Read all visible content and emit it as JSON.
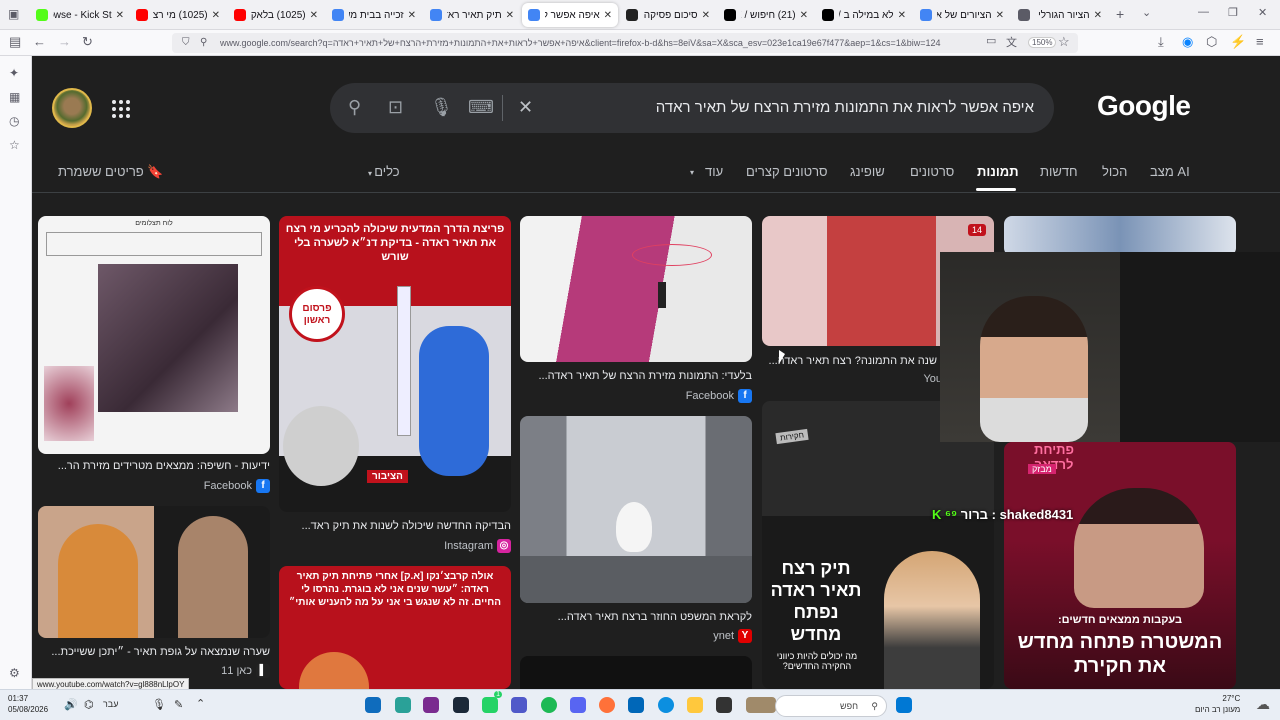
{
  "browser": {
    "tabs": [
      {
        "label": "Browse - Kick St",
        "color": "#53fc18"
      },
      {
        "label": "(1025) מי רצח א",
        "color": "#ff0000"
      },
      {
        "label": "(1025) בלאקביר",
        "color": "#ff0000"
      },
      {
        "label": "זכייה בבית משפ",
        "color": "#4285f4"
      },
      {
        "label": "תיק תאיר ראדה",
        "color": "#4285f4"
      },
      {
        "label": "איפה אפשר לר",
        "color": "#4285f4"
      },
      {
        "label": "סיכום פסיקה בנ",
        "color": "#222222"
      },
      {
        "label": "(21) חיפוש / X",
        "color": "#000000"
      },
      {
        "label": "לא במילה ב / X",
        "color": "#000000"
      },
      {
        "label": "הציורים של א ק",
        "color": "#4285f4"
      },
      {
        "label": "הציור הגורלי של",
        "color": "#5b5b66"
      }
    ],
    "url": "www.google.com/search?q=איפה+אפשר+לראות+את+התמונות+מזירת+הרצח+של+תאיר+ראדה&client=firefox-b-d&hs=8eiV&sa=X&sca_esv=023e1ca19e67f477&aep=1&cs=1&biw=124",
    "zoom": "150%"
  },
  "search": {
    "query": "איפה אפשר לראות את התמונות מזירת הרצח של תאיר ראדה",
    "logo": "Google",
    "tabs": [
      "מצב AI",
      "הכול",
      "חדשות",
      "תמונות",
      "סרטונים",
      "שופינג",
      "סרטונים קצרים",
      "עוד"
    ],
    "active_tab": "תמונות",
    "tools": "כלים",
    "saved": "פריטים ששמרת"
  },
  "results": [
    {
      "caption": "ידיעות - חשיפה: ממצאים מטרידים מזירת הר...",
      "source": "Facebook",
      "badge_color": "#1877f2",
      "header": "לוח תצלומים"
    },
    {
      "caption": "שערה שנמצאה על גופת תאיר - ״יתכן ששייכת...",
      "source": "כאן 11",
      "badge_color": "#222222"
    },
    {
      "caption": "הבדיקה החדשה שיכולה לשנות את תיק ראד...",
      "source": "Instagram",
      "badge_color": "#d6249f",
      "overlay": "פריצת הדרך המדעית שיכולה להכריע מי רצח את תאיר ראדה - בדיקת דנ״א לשערה בלי שורש",
      "stamp": "פרסום ראשון",
      "tag": "הציבור"
    },
    {
      "overlay": "אולה קרבצ׳נקו [א.ק] אחרי פתיחת תיק תאיר ראדה: ״עשר שנים אני לא בוגרת. נהרסו לי החיים. זה לא שנגש בי אני על מה להעניש אותי״"
    },
    {
      "caption": "בלעדי: התמונות מזירת הרצח של תאיר ראדה...",
      "source": "Facebook",
      "badge_color": "#1877f2"
    },
    {
      "caption": "לקראת המשפט החוזר ברצח תאיר ראדה...",
      "source": "ynet",
      "badge_color": "#e00000"
    },
    {
      "caption": "שנה את התמונה? רצח תאיר ראדה...",
      "source": "You",
      "badge_color": "#ff0000",
      "count": "14"
    },
    {
      "overlay": "תיק רצח תאיר ראדה נפתח מחדש",
      "sub": "מה יכולים להיות כיווני החקירה החדשים?",
      "label": "חקירות"
    },
    {
      "overlay": "המשטרה פתחה מחדש את חקירת",
      "sub": "בעקבות ממצאים חדשים:",
      "top": "פתיחת לרדאר",
      "tag": "מבזק"
    }
  ],
  "overlays": {
    "chat": "shaked8431 : ברור",
    "status_url": "www.youtube.com/watch?v=gl888nLlpOY"
  },
  "taskbar": {
    "time": "01:37",
    "date": "05/08/2026",
    "lang": "עבר",
    "search": "חפש",
    "temp": "27°C",
    "weather": "מעונן רב היום",
    "badge": "1"
  }
}
